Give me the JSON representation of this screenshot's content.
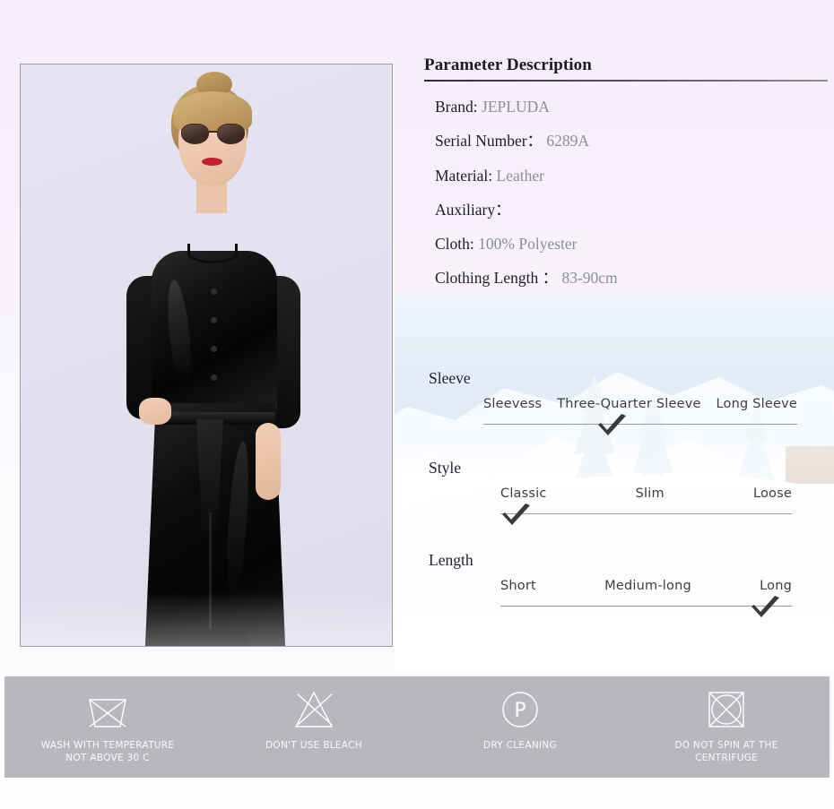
{
  "spec": {
    "title": "Parameter Description",
    "rows": [
      {
        "label": "Brand:",
        "value": "JEPLUDA"
      },
      {
        "label": "Serial Number：",
        "value": "6289A"
      },
      {
        "label": "Material:",
        "value": "Leather"
      },
      {
        "label": "Auxiliary：",
        "value": ""
      },
      {
        "label": "Cloth:",
        "value": "100% Polyester"
      },
      {
        "label": "Clothing Length ：",
        "value": "83-90cm"
      }
    ]
  },
  "options": [
    {
      "title": "Sleeve",
      "items": [
        "Sleevess",
        "Three-Quarter Sleeve",
        "Long Sleeve"
      ],
      "selected": "Three-Quarter Sleeve"
    },
    {
      "title": "Style",
      "items": [
        "Classic",
        "Slim",
        "Loose"
      ],
      "selected": "Classic"
    },
    {
      "title": "Length",
      "items": [
        "Short",
        "Medium-long",
        "Long"
      ],
      "selected": "Long"
    }
  ],
  "care": [
    {
      "icon": "no-wash-icon",
      "text": "WASH WITH TEMPERATURE\nNOT ABOVE 30 C"
    },
    {
      "icon": "no-bleach-icon",
      "text": "DON'T USE BLEACH"
    },
    {
      "icon": "dry-cleaning-icon",
      "text": "DRY CLEANING"
    },
    {
      "icon": "no-spin-icon",
      "text": "DO NOT SPIN AT THE\nCENTRIFUGE"
    }
  ],
  "colors": {
    "page_background": "#f8f4fb",
    "care_bar": "#b7b7bd",
    "label_text": "#1d1d29",
    "value_text": "#8c8c9c",
    "check_mark": "#3a3a3a",
    "rule": "#9a9aa6"
  }
}
